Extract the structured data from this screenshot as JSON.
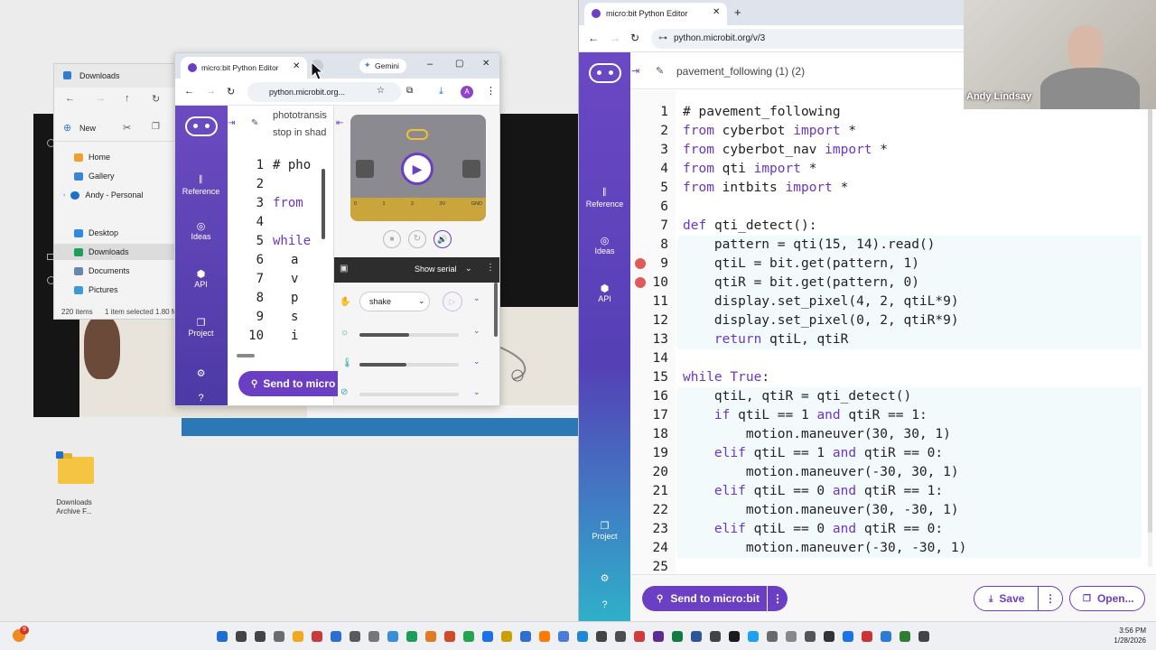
{
  "colors": {
    "accent": "#6b3fc4",
    "sidebar": "#5540b6",
    "keyword": "#6a37c5",
    "breakpoint": "#e05a5a"
  },
  "explorer": {
    "tab_title": "Downloads",
    "new_label": "New",
    "nav": [
      "Home",
      "Gallery",
      "Andy - Personal",
      "Desktop",
      "Downloads",
      "Documents",
      "Pictures"
    ],
    "status_items": "220 items",
    "status_selected": "1 item selected  1.80 M"
  },
  "desktop_icon": {
    "label_line1": "Downloads",
    "label_line2": "Archive F..."
  },
  "small_window": {
    "tab_title": "micro:bit Python Editor",
    "tab2_title": "Gemini",
    "url": "python.microbit.org...",
    "avatar_letter": "A",
    "project_text_1": "phototransis",
    "project_text_2": "stop in shad",
    "sidebar": [
      "Reference",
      "Ideas",
      "API",
      "Project"
    ],
    "code_lines": [
      {
        "n": "1",
        "t": "# pho"
      },
      {
        "n": "2",
        "t": ""
      },
      {
        "n": "3",
        "t": "from"
      },
      {
        "n": "4",
        "t": ""
      },
      {
        "n": "5",
        "t": "while"
      },
      {
        "n": "6",
        "t": "a"
      },
      {
        "n": "7",
        "t": "v"
      },
      {
        "n": "8",
        "t": "p"
      },
      {
        "n": "9",
        "t": "s"
      },
      {
        "n": "10",
        "t": "i"
      }
    ],
    "sim_pins": [
      "0",
      "1",
      "2",
      "3V",
      "GND"
    ],
    "serial_label": "Show serial",
    "gesture_value": "shake",
    "send_label": "Send to micro"
  },
  "main_window": {
    "tab_title": "micro:bit Python Editor",
    "url": "python.microbit.org/v/3",
    "project_name": "pavement_following (1) (2)",
    "webcam_name": "Andy Lindsay",
    "sidebar": [
      "Reference",
      "Ideas",
      "API",
      "Project"
    ],
    "send_label": "Send to micro:bit",
    "save_label": "Save",
    "open_label": "Open...",
    "code_lines": [
      {
        "n": "1",
        "text": "# pavement_following"
      },
      {
        "n": "2",
        "text": "from cyberbot import *"
      },
      {
        "n": "3",
        "text": "from cyberbot_nav import *"
      },
      {
        "n": "4",
        "text": "from qti import *"
      },
      {
        "n": "5",
        "text": "from intbits import *"
      },
      {
        "n": "6",
        "text": ""
      },
      {
        "n": "7",
        "text": "def qti_detect():"
      },
      {
        "n": "8",
        "text": "    pattern = qti(15, 14).read()"
      },
      {
        "n": "9",
        "text": "    qtiL = bit.get(pattern, 1)"
      },
      {
        "n": "10",
        "text": "    qtiR = bit.get(pattern, 0)"
      },
      {
        "n": "11",
        "text": "    display.set_pixel(4, 2, qtiL*9)"
      },
      {
        "n": "12",
        "text": "    display.set_pixel(0, 2, qtiR*9)"
      },
      {
        "n": "13",
        "text": "    return qtiL, qtiR"
      },
      {
        "n": "14",
        "text": ""
      },
      {
        "n": "15",
        "text": "while True:"
      },
      {
        "n": "16",
        "text": "    qtiL, qtiR = qti_detect()"
      },
      {
        "n": "17",
        "text": "    if qtiL == 1 and qtiR == 1:"
      },
      {
        "n": "18",
        "text": "        motion.maneuver(30, 30, 1)"
      },
      {
        "n": "19",
        "text": "    elif qtiL == 1 and qtiR == 0:"
      },
      {
        "n": "20",
        "text": "        motion.maneuver(-30, 30, 1)"
      },
      {
        "n": "21",
        "text": "    elif qtiL == 0 and qtiR == 1:"
      },
      {
        "n": "22",
        "text": "        motion.maneuver(30, -30, 1)"
      },
      {
        "n": "23",
        "text": "    elif qtiL == 0 and qtiR == 0:"
      },
      {
        "n": "24",
        "text": "        motion.maneuver(-30, -30, 1)"
      },
      {
        "n": "25",
        "text": ""
      }
    ],
    "breakpoint_lines": [
      "9",
      "10"
    ]
  },
  "taskbar": {
    "time": "3:56 PM",
    "date": "1/28/2026",
    "notification_count": "9"
  }
}
